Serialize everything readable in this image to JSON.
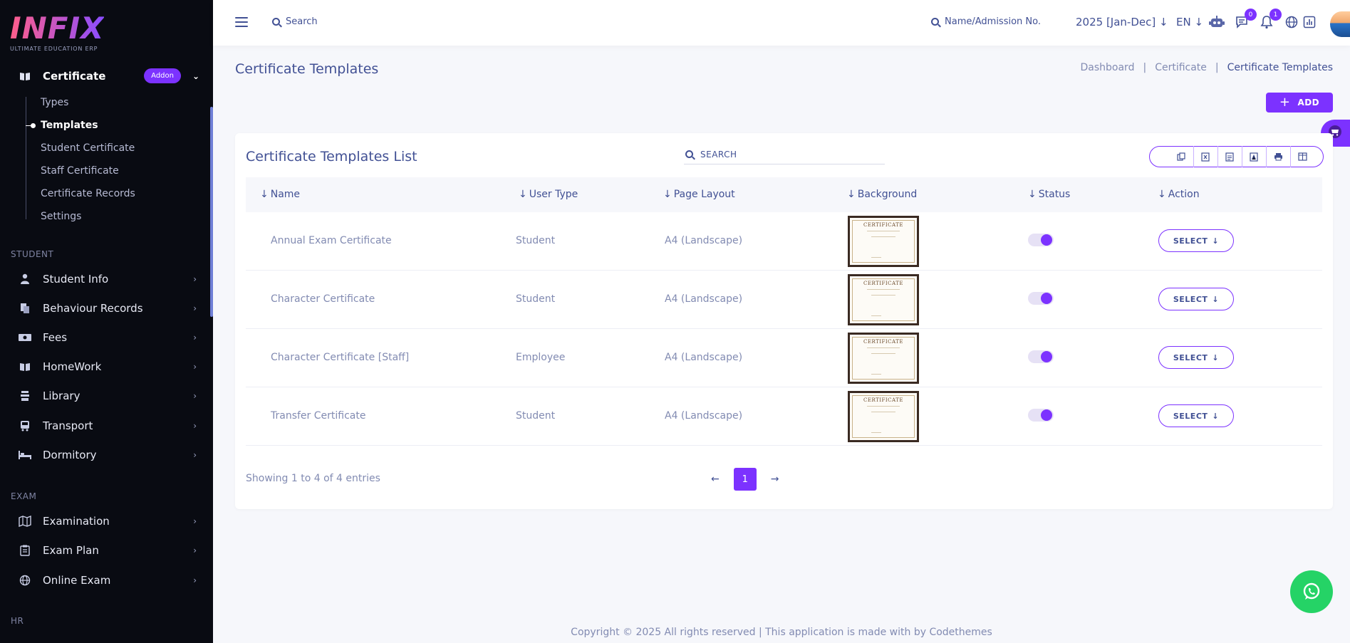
{
  "brand": {
    "logo_text": "INFIX",
    "tagline": "ULTIMATE EDUCATION ERP"
  },
  "sidebar": {
    "certificate": {
      "label": "Certificate",
      "badge": "Addon"
    },
    "sub_items": [
      "Types",
      "Templates",
      "Student Certificate",
      "Staff Certificate",
      "Certificate Records",
      "Settings"
    ],
    "sections": {
      "student": "STUDENT",
      "exam": "EXAM",
      "hr": "HR"
    },
    "student_items": [
      "Student Info",
      "Behaviour Records",
      "Fees",
      "HomeWork",
      "Library",
      "Transport",
      "Dormitory"
    ],
    "exam_items": [
      "Examination",
      "Exam Plan",
      "Online Exam"
    ]
  },
  "topbar": {
    "search_label": "Search",
    "admission_search": "Name/Admission No.",
    "year": "2025 [Jan-Dec]",
    "language": "EN",
    "chat_badge": "0",
    "notification_badge": "1"
  },
  "header": {
    "title": "Certificate Templates",
    "breadcrumb": [
      "Dashboard",
      "Certificate",
      "Certificate Templates"
    ],
    "add_label": "ADD"
  },
  "list": {
    "title": "Certificate Templates List",
    "search_placeholder": "SEARCH",
    "columns": [
      "Name",
      "User Type",
      "Page Layout",
      "Background",
      "Status",
      "Action"
    ],
    "rows": [
      {
        "name": "Annual Exam Certificate",
        "user_type": "Student",
        "page_layout": "A4 (Landscape)",
        "thumb_title": "CERTIFICATE",
        "status": true,
        "action": "SELECT"
      },
      {
        "name": "Character Certificate",
        "user_type": "Student",
        "page_layout": "A4 (Landscape)",
        "thumb_title": "CERTIFICATE",
        "status": true,
        "action": "SELECT"
      },
      {
        "name": "Character Certificate [Staff]",
        "user_type": "Employee",
        "page_layout": "A4 (Landscape)",
        "thumb_title": "CERTIFICATE",
        "status": true,
        "action": "SELECT"
      },
      {
        "name": "Transfer Certificate",
        "user_type": "Student",
        "page_layout": "A4 (Landscape)",
        "thumb_title": "CERTIFICATE",
        "status": true,
        "action": "SELECT"
      }
    ],
    "showing": "Showing 1 to 4 of 4 entries",
    "current_page": "1"
  },
  "footer": {
    "copyright": "Copyright © 2025 All rights reserved | This application is made with by Codethemes"
  },
  "colors": {
    "accent": "#7c32ff",
    "text": "#415094",
    "muted": "#828bb2",
    "sidebar_bg": "#090b12",
    "whatsapp": "#25d366"
  }
}
